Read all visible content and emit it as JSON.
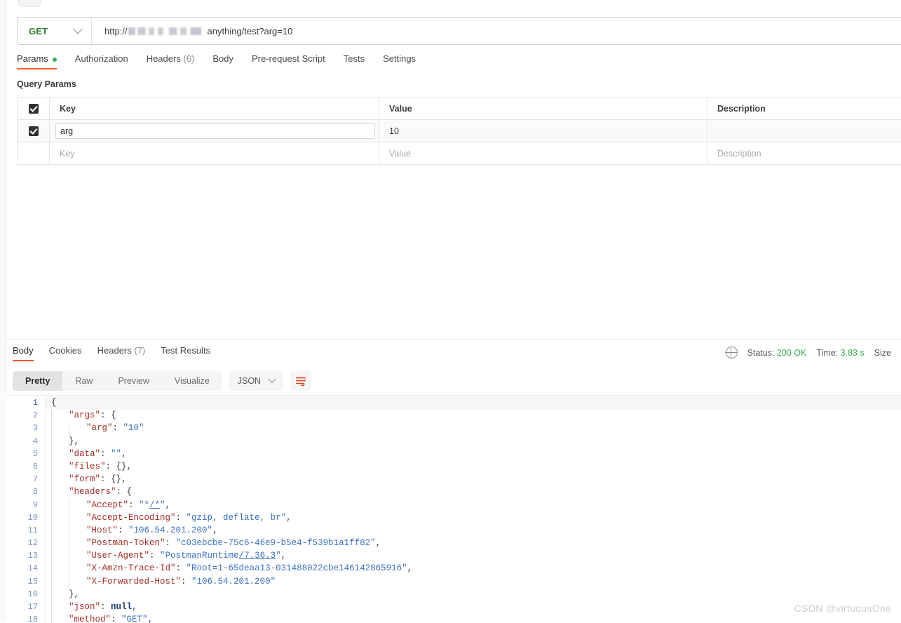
{
  "request": {
    "method": "GET",
    "method_chevron_icon": "chevron-down-icon",
    "url_prefix": "http://",
    "url_redacted": true,
    "url_suffix": "anything/test?arg=10",
    "tabs": [
      {
        "label": "Params",
        "active": true,
        "dot": true
      },
      {
        "label": "Authorization",
        "active": false,
        "dot": false
      },
      {
        "label": "Headers",
        "count": "(6)",
        "active": false,
        "dot": false
      },
      {
        "label": "Body",
        "active": false,
        "dot": false
      },
      {
        "label": "Pre-request Script",
        "active": false,
        "dot": false
      },
      {
        "label": "Tests",
        "active": false,
        "dot": false
      },
      {
        "label": "Settings",
        "active": false,
        "dot": false
      }
    ]
  },
  "query_params": {
    "section_title": "Query Params",
    "columns": [
      "Key",
      "Value",
      "Description"
    ],
    "rows": [
      {
        "checked": true,
        "key": "arg",
        "value": "10",
        "description": ""
      }
    ],
    "placeholder_row": {
      "key": "Key",
      "value": "Value",
      "description": "Description"
    }
  },
  "response": {
    "tabs": [
      {
        "label": "Body",
        "active": true
      },
      {
        "label": "Cookies",
        "active": false
      },
      {
        "label": "Headers",
        "count": "(7)",
        "active": false
      },
      {
        "label": "Test Results",
        "active": false
      }
    ],
    "meta": {
      "globe_icon": "globe-icon",
      "status_label": "Status:",
      "status_value": "200 OK",
      "time_label": "Time:",
      "time_value": "3.83 s",
      "size_label": "Size"
    },
    "format_buttons": [
      {
        "label": "Pretty",
        "active": true
      },
      {
        "label": "Raw",
        "active": false
      },
      {
        "label": "Preview",
        "active": false
      },
      {
        "label": "Visualize",
        "active": false
      }
    ],
    "language": "JSON",
    "language_chevron_icon": "chevron-down-icon",
    "wrap_icon": "wrap-text-icon",
    "body_lines": [
      {
        "n": "1",
        "indent": 0,
        "tokens": [
          {
            "t": "p",
            "v": "{"
          }
        ]
      },
      {
        "n": "2",
        "indent": 1,
        "tokens": [
          {
            "t": "k",
            "v": "\"args\""
          },
          {
            "t": "p",
            "v": ": {"
          }
        ]
      },
      {
        "n": "3",
        "indent": 2,
        "tokens": [
          {
            "t": "k",
            "v": "\"arg\""
          },
          {
            "t": "p",
            "v": ": "
          },
          {
            "t": "s",
            "v": "\"10\""
          }
        ]
      },
      {
        "n": "4",
        "indent": 1,
        "tokens": [
          {
            "t": "p",
            "v": "},"
          }
        ]
      },
      {
        "n": "5",
        "indent": 1,
        "tokens": [
          {
            "t": "k",
            "v": "\"data\""
          },
          {
            "t": "p",
            "v": ": "
          },
          {
            "t": "s",
            "v": "\"\""
          },
          {
            "t": "p",
            "v": ","
          }
        ]
      },
      {
        "n": "6",
        "indent": 1,
        "tokens": [
          {
            "t": "k",
            "v": "\"files\""
          },
          {
            "t": "p",
            "v": ": {},"
          }
        ]
      },
      {
        "n": "7",
        "indent": 1,
        "tokens": [
          {
            "t": "k",
            "v": "\"form\""
          },
          {
            "t": "p",
            "v": ": {},"
          }
        ]
      },
      {
        "n": "8",
        "indent": 1,
        "tokens": [
          {
            "t": "k",
            "v": "\"headers\""
          },
          {
            "t": "p",
            "v": ": {"
          }
        ]
      },
      {
        "n": "9",
        "indent": 2,
        "tokens": [
          {
            "t": "k",
            "v": "\"Accept\""
          },
          {
            "t": "p",
            "v": ": "
          },
          {
            "t": "s",
            "v": "\"*"
          },
          {
            "t": "su",
            "v": "/*"
          },
          {
            "t": "s",
            "v": "\""
          },
          {
            "t": "p",
            "v": ","
          }
        ]
      },
      {
        "n": "10",
        "indent": 2,
        "tokens": [
          {
            "t": "k",
            "v": "\"Accept-Encoding\""
          },
          {
            "t": "p",
            "v": ": "
          },
          {
            "t": "s",
            "v": "\"gzip, deflate, br\""
          },
          {
            "t": "p",
            "v": ","
          }
        ]
      },
      {
        "n": "11",
        "indent": 2,
        "tokens": [
          {
            "t": "k",
            "v": "\"Host\""
          },
          {
            "t": "p",
            "v": ": "
          },
          {
            "t": "s",
            "v": "\"106.54.201.200\""
          },
          {
            "t": "p",
            "v": ","
          }
        ]
      },
      {
        "n": "12",
        "indent": 2,
        "tokens": [
          {
            "t": "k",
            "v": "\"Postman-Token\""
          },
          {
            "t": "p",
            "v": ": "
          },
          {
            "t": "s",
            "v": "\"c03ebcbe-75c6-46e9-b5e4-f539b1a1ff82\""
          },
          {
            "t": "p",
            "v": ","
          }
        ]
      },
      {
        "n": "13",
        "indent": 2,
        "tokens": [
          {
            "t": "k",
            "v": "\"User-Agent\""
          },
          {
            "t": "p",
            "v": ": "
          },
          {
            "t": "s",
            "v": "\"PostmanRuntime"
          },
          {
            "t": "su",
            "v": "/7.36.3"
          },
          {
            "t": "s",
            "v": "\""
          },
          {
            "t": "p",
            "v": ","
          }
        ]
      },
      {
        "n": "14",
        "indent": 2,
        "tokens": [
          {
            "t": "k",
            "v": "\"X-Amzn-Trace-Id\""
          },
          {
            "t": "p",
            "v": ": "
          },
          {
            "t": "s",
            "v": "\"Root=1-65deaa13-031488022cbe146142865916\""
          },
          {
            "t": "p",
            "v": ","
          }
        ]
      },
      {
        "n": "15",
        "indent": 2,
        "tokens": [
          {
            "t": "k",
            "v": "\"X-Forwarded-Host\""
          },
          {
            "t": "p",
            "v": ": "
          },
          {
            "t": "s",
            "v": "\"106.54.201.200\""
          }
        ]
      },
      {
        "n": "16",
        "indent": 1,
        "tokens": [
          {
            "t": "p",
            "v": "},"
          }
        ]
      },
      {
        "n": "17",
        "indent": 1,
        "tokens": [
          {
            "t": "k",
            "v": "\"json\""
          },
          {
            "t": "p",
            "v": ": "
          },
          {
            "t": "n",
            "v": "null"
          },
          {
            "t": "p",
            "v": ","
          }
        ]
      },
      {
        "n": "18",
        "indent": 1,
        "tokens": [
          {
            "t": "k",
            "v": "\"method\""
          },
          {
            "t": "p",
            "v": ": "
          },
          {
            "t": "s",
            "v": "\"GET\""
          },
          {
            "t": "p",
            "v": ","
          }
        ]
      }
    ]
  },
  "watermark": "CSDN @virtuousOne"
}
